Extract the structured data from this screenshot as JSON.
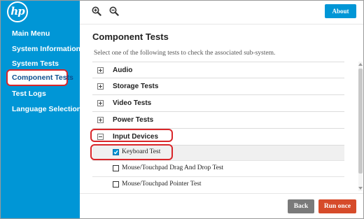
{
  "logo": {
    "text": "hp"
  },
  "sidebar": {
    "items": [
      {
        "label": "Main Menu",
        "selected": false
      },
      {
        "label": "System Information",
        "selected": false
      },
      {
        "label": "System Tests",
        "selected": false
      },
      {
        "label": "Component Tests",
        "selected": true
      },
      {
        "label": "Test Logs",
        "selected": false
      },
      {
        "label": "Language Selection",
        "selected": false
      }
    ]
  },
  "toolbar": {
    "zoom_in_icon": "zoom-in-icon",
    "zoom_out_icon": "zoom-out-icon",
    "about_label": "About"
  },
  "main": {
    "title": "Component Tests",
    "subtitle": "Select one of the following tests to check the associated sub-system.",
    "categories": [
      {
        "label": "Audio",
        "expanded": false
      },
      {
        "label": "Storage Tests",
        "expanded": false
      },
      {
        "label": "Video Tests",
        "expanded": false
      },
      {
        "label": "Power Tests",
        "expanded": false
      },
      {
        "label": "Input Devices",
        "expanded": true
      }
    ],
    "input_devices_tests": [
      {
        "label": "Keyboard Test",
        "checked": true
      },
      {
        "label": "Mouse/Touchpad Drag And Drop Test",
        "checked": false
      },
      {
        "label": "Mouse/Touchpad Pointer Test",
        "checked": false
      }
    ]
  },
  "footer": {
    "back_label": "Back",
    "run_label": "Run once"
  },
  "colors": {
    "sidebar_bg": "#0096d6",
    "accent": "#0096d6",
    "run_button": "#d64b2a",
    "back_button": "#7a7a7a",
    "highlight": "#d9262a"
  }
}
